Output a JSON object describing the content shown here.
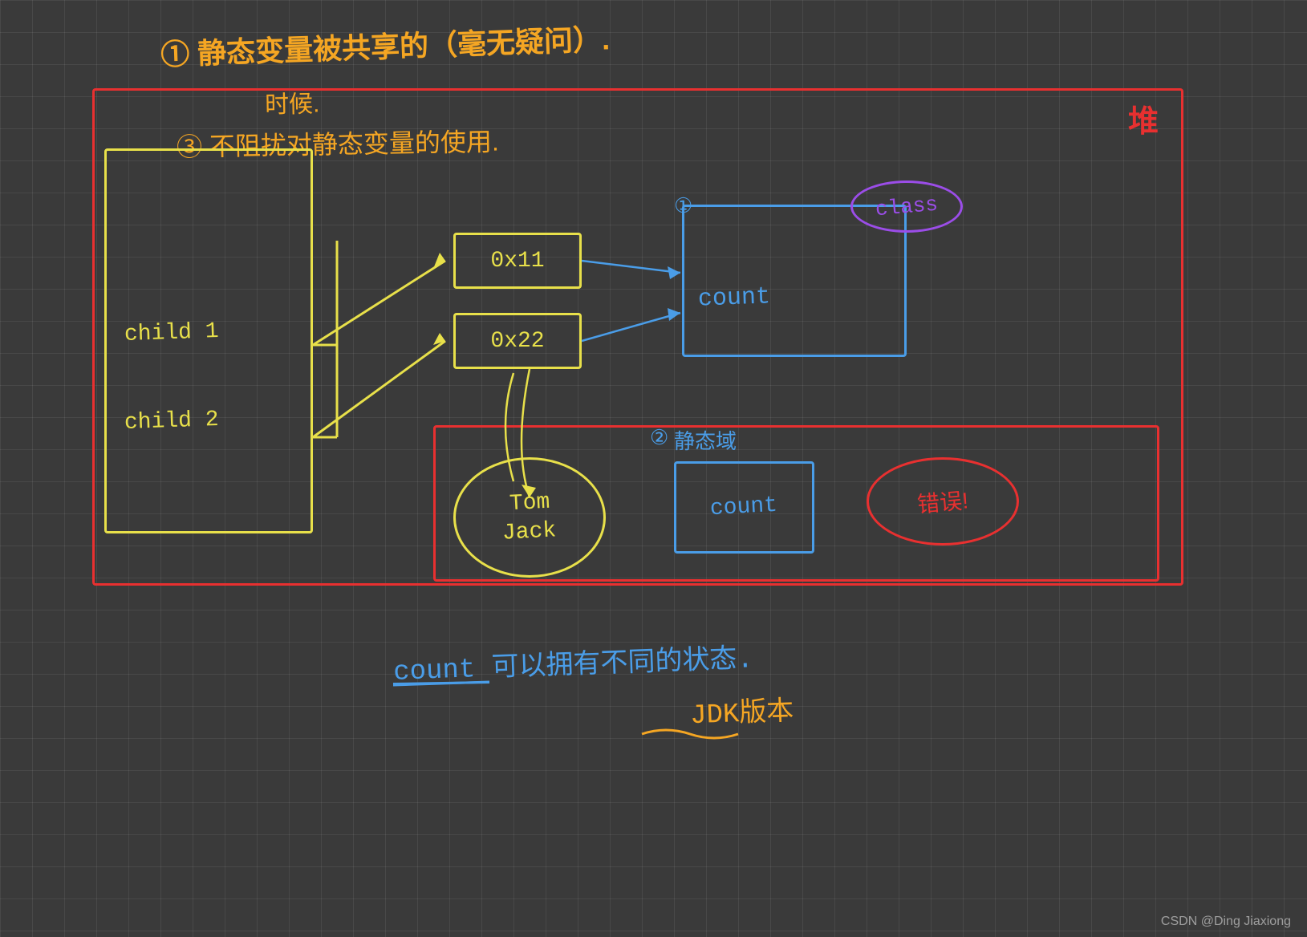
{
  "title": {
    "line1": "① 静态变量被共享的（毫无疑问）.",
    "line2": "时候.",
    "line3": "③ 不阻扰对静态变量的使用."
  },
  "heap_label": "堆",
  "child1_label": "child 1",
  "child2_label": "child 2",
  "addr1": "0x11",
  "addr2": "0x22",
  "count_label": "count",
  "class_label": "class",
  "circle1": "①",
  "circle2": "②",
  "static_area_label": "静态域",
  "static_count": "count",
  "error_label": "错误!",
  "tom_label": "Tom",
  "jack_label": "Jack",
  "bottom_text": "count 可以拥有不同的状态.",
  "jdk_text": "JDK版本",
  "watermark": "CSDN @Ding Jiaxiong"
}
